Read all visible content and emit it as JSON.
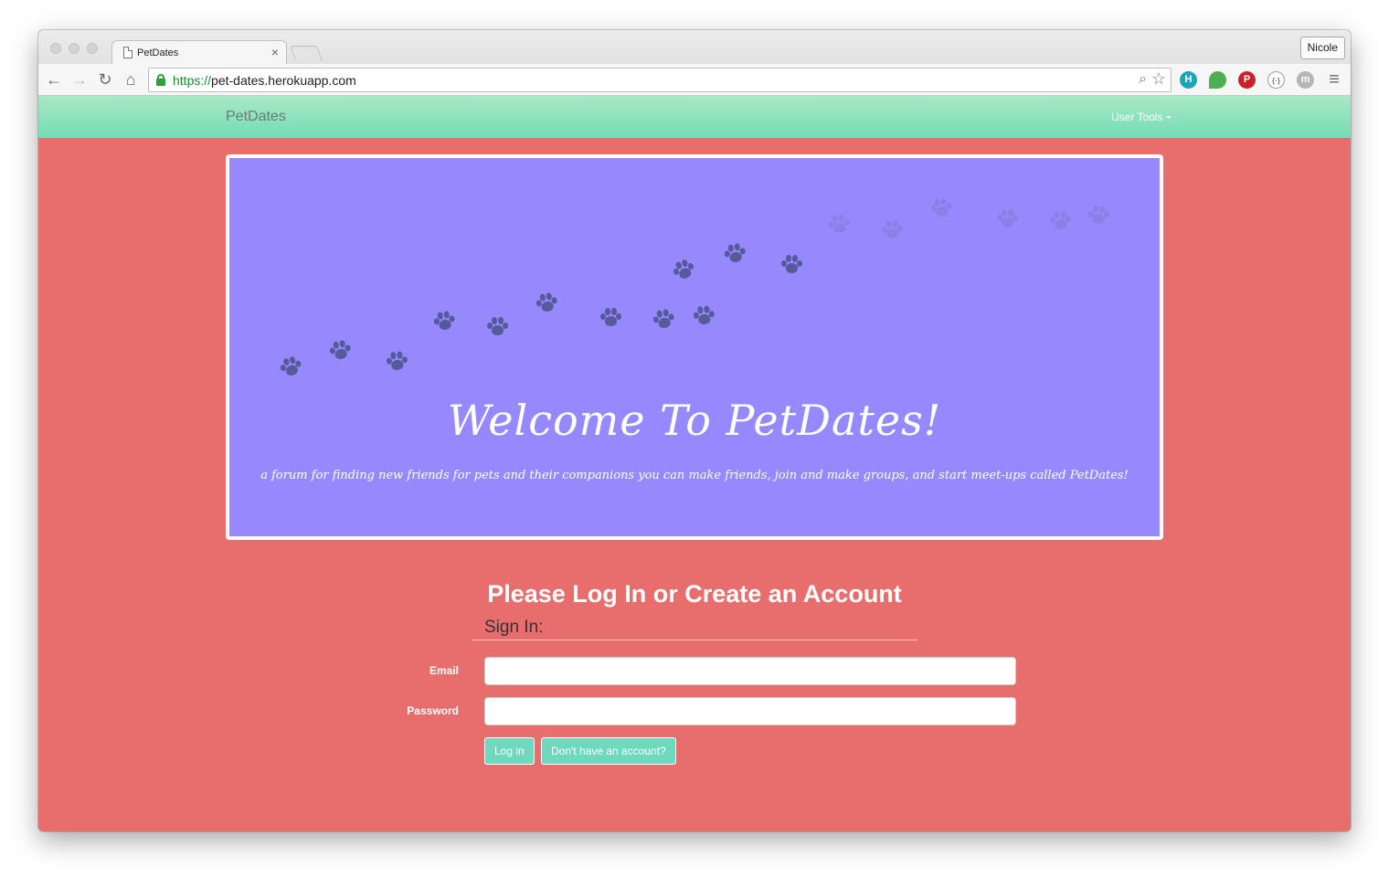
{
  "browser": {
    "tab_title": "PetDates",
    "tab_close": "×",
    "profile_name": "Nicole",
    "url_scheme": "https://",
    "url_host": "pet-dates.herokuapp.com",
    "nav": {
      "back": "←",
      "forward": "→",
      "reload": "↻",
      "home": "⌂"
    },
    "omnibox_icons": {
      "zoom": "⌕",
      "bookmark": "☆"
    },
    "extensions": [
      {
        "name": "hootsuite-icon",
        "glyph": "H",
        "color": "#1aa6b7"
      },
      {
        "name": "evernote-icon",
        "glyph": "",
        "color": "#4caf50"
      },
      {
        "name": "pinterest-icon",
        "glyph": "P",
        "color": "#cb2027"
      },
      {
        "name": "code-icon",
        "glyph": "{·}",
        "color": "#9e9e9e"
      },
      {
        "name": "m-icon",
        "glyph": "m",
        "color": "#9e9e9e"
      }
    ],
    "menu_glyph": "≡"
  },
  "site": {
    "brand": "PetDates",
    "user_tools": "User Tools",
    "hero": {
      "title": "Welcome To PetDates!",
      "tagline": "a forum for finding new friends for pets and their companions you can make friends, join and make groups, and start meet-ups called PetDates!"
    },
    "login": {
      "heading": "Please Log In or Create an Account",
      "legend": "Sign In:",
      "email_label": "Email",
      "email_value": "",
      "password_label": "Password",
      "password_value": "",
      "login_button": "Log in",
      "signup_button": "Don't have an account?"
    }
  },
  "colors": {
    "page_background": "#e86e6e",
    "navbar_gradient_top": "#a9e9c6",
    "navbar_gradient_bottom": "#73dcb4",
    "hero_background": "#9689fd",
    "button": "#6fd9bd"
  }
}
